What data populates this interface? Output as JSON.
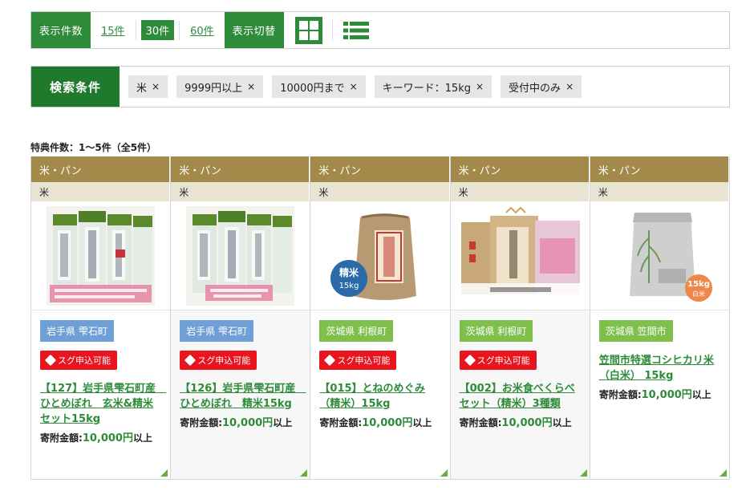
{
  "display": {
    "count_label": "表示件数",
    "counts": [
      "15件",
      "30件",
      "60件"
    ],
    "active_count": "30件",
    "view_label": "表示切替"
  },
  "search": {
    "label": "検索条件",
    "chips": [
      "米",
      "9999円以上",
      "10000円まで",
      "キーワード：15kg",
      "受付中のみ"
    ],
    "remove_glyph": "×"
  },
  "result_count": "特典件数：1〜5件（全5件）",
  "price_label": "寄附金額:",
  "price_suffix": "以上",
  "products": [
    {
      "category": "米・パン",
      "subcategory": "米",
      "region": "岩手県 雫石町",
      "region_type": "iwate",
      "badge": "スグ申込可能",
      "title": "【127】岩手県雫石町産　ひとめぼれ　玄米&精米セット15kg",
      "price": "10,000円"
    },
    {
      "category": "米・パン",
      "subcategory": "米",
      "region": "岩手県 雫石町",
      "region_type": "iwate",
      "badge": "スグ申込可能",
      "title": "【126】岩手県雫石町産　ひとめぼれ　精米15kg",
      "price": "10,000円"
    },
    {
      "category": "米・パン",
      "subcategory": "米",
      "region": "茨城県 利根町",
      "region_type": "ibaraki",
      "badge": "スグ申込可能",
      "title": "【015】とねのめぐみ（精米）15kg",
      "price": "10,000円"
    },
    {
      "category": "米・パン",
      "subcategory": "米",
      "region": "茨城県 利根町",
      "region_type": "ibaraki",
      "badge": "スグ申込可能",
      "title": "【002】お米食べくらべセット（精米）3種類",
      "price": "10,000円"
    },
    {
      "category": "米・パン",
      "subcategory": "米",
      "region": "茨城県 笠間市",
      "region_type": "ibaraki",
      "badge": "",
      "title": "笠間市特選コシヒカリ米（白米） 15kg",
      "price": "10,000円"
    }
  ],
  "images": [
    {
      "icon": "rice-bags-hitomebore-icon"
    },
    {
      "icon": "rice-bags-hitomebore-icon"
    },
    {
      "icon": "rice-sack-tone-icon",
      "label_a": "精米",
      "label_b": "15kg"
    },
    {
      "icon": "rice-bags-trio-icon"
    },
    {
      "icon": "rice-bag-kasama-icon",
      "label_a": "15kg",
      "label_b": "白米"
    }
  ],
  "colors": {
    "accent": "#2e8b3a",
    "category": "#a38a4a",
    "badge": "#e8141e",
    "iwate": "#6f9fd6",
    "ibaraki": "#7fbf4b"
  }
}
